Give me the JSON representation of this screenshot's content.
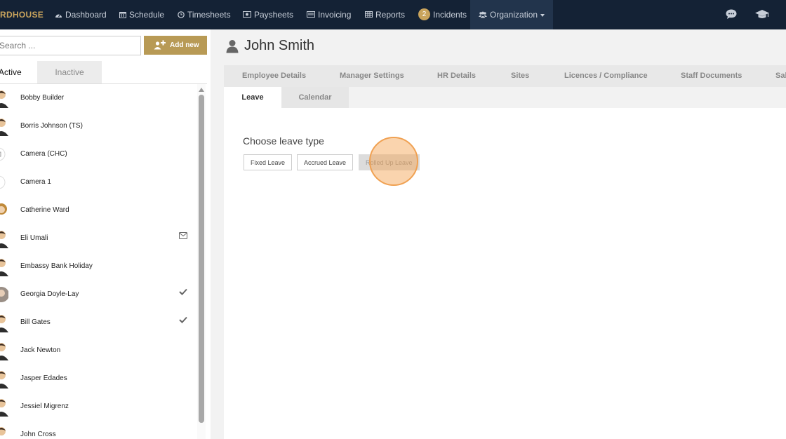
{
  "nav": {
    "brand": "RDHOUSE",
    "items": [
      {
        "label": "Dashboard",
        "icon": "dashboard-icon"
      },
      {
        "label": "Schedule",
        "icon": "calendar-icon"
      },
      {
        "label": "Timesheets",
        "icon": "clock-icon"
      },
      {
        "label": "Paysheets",
        "icon": "money-icon"
      },
      {
        "label": "Invoicing",
        "icon": "invoice-icon"
      },
      {
        "label": "Reports",
        "icon": "table-icon"
      },
      {
        "label": "Incidents",
        "icon": "badge-icon",
        "badge": "2"
      },
      {
        "label": "Organization",
        "icon": "users-icon"
      }
    ],
    "right_icons": [
      "chat-icon",
      "graduation-cap-icon"
    ]
  },
  "sidebar": {
    "search_placeholder": "Search ...",
    "add_label": "Add new",
    "tabs": {
      "active": "Active",
      "inactive": "Inactive"
    },
    "people": [
      {
        "name": "Bobby Builder",
        "status": ""
      },
      {
        "name": "Borris Johnson (TS)",
        "status": ""
      },
      {
        "name": "Camera (CHC)",
        "status": ""
      },
      {
        "name": "Camera 1",
        "status": ""
      },
      {
        "name": "Catherine Ward",
        "status": ""
      },
      {
        "name": "Eli Umali",
        "status": "envelope-icon"
      },
      {
        "name": "Embassy Bank Holiday",
        "status": ""
      },
      {
        "name": "Georgia Doyle-Lay",
        "status": "check-icon"
      },
      {
        "name": "Bill Gates",
        "status": "check-icon"
      },
      {
        "name": "Jack Newton",
        "status": ""
      },
      {
        "name": "Jasper Edades",
        "status": ""
      },
      {
        "name": "Jessiel Migrenz",
        "status": ""
      },
      {
        "name": "John Cross",
        "status": ""
      }
    ]
  },
  "main": {
    "title": "John Smith",
    "tabs": [
      "Employee Details",
      "Manager Settings",
      "HR Details",
      "Sites",
      "Licences / Compliance",
      "Staff Documents",
      "Sal"
    ],
    "subtabs": {
      "active": "Leave",
      "other": "Calendar"
    },
    "choose_label": "Choose leave type",
    "leave_buttons": [
      "Fixed Leave",
      "Accrued Leave",
      "Rolled Up Leave"
    ]
  },
  "colors": {
    "navbar": "#142235",
    "accent": "#c9a45c",
    "add_button": "#b89a55",
    "click_highlight": "#f0a152"
  }
}
